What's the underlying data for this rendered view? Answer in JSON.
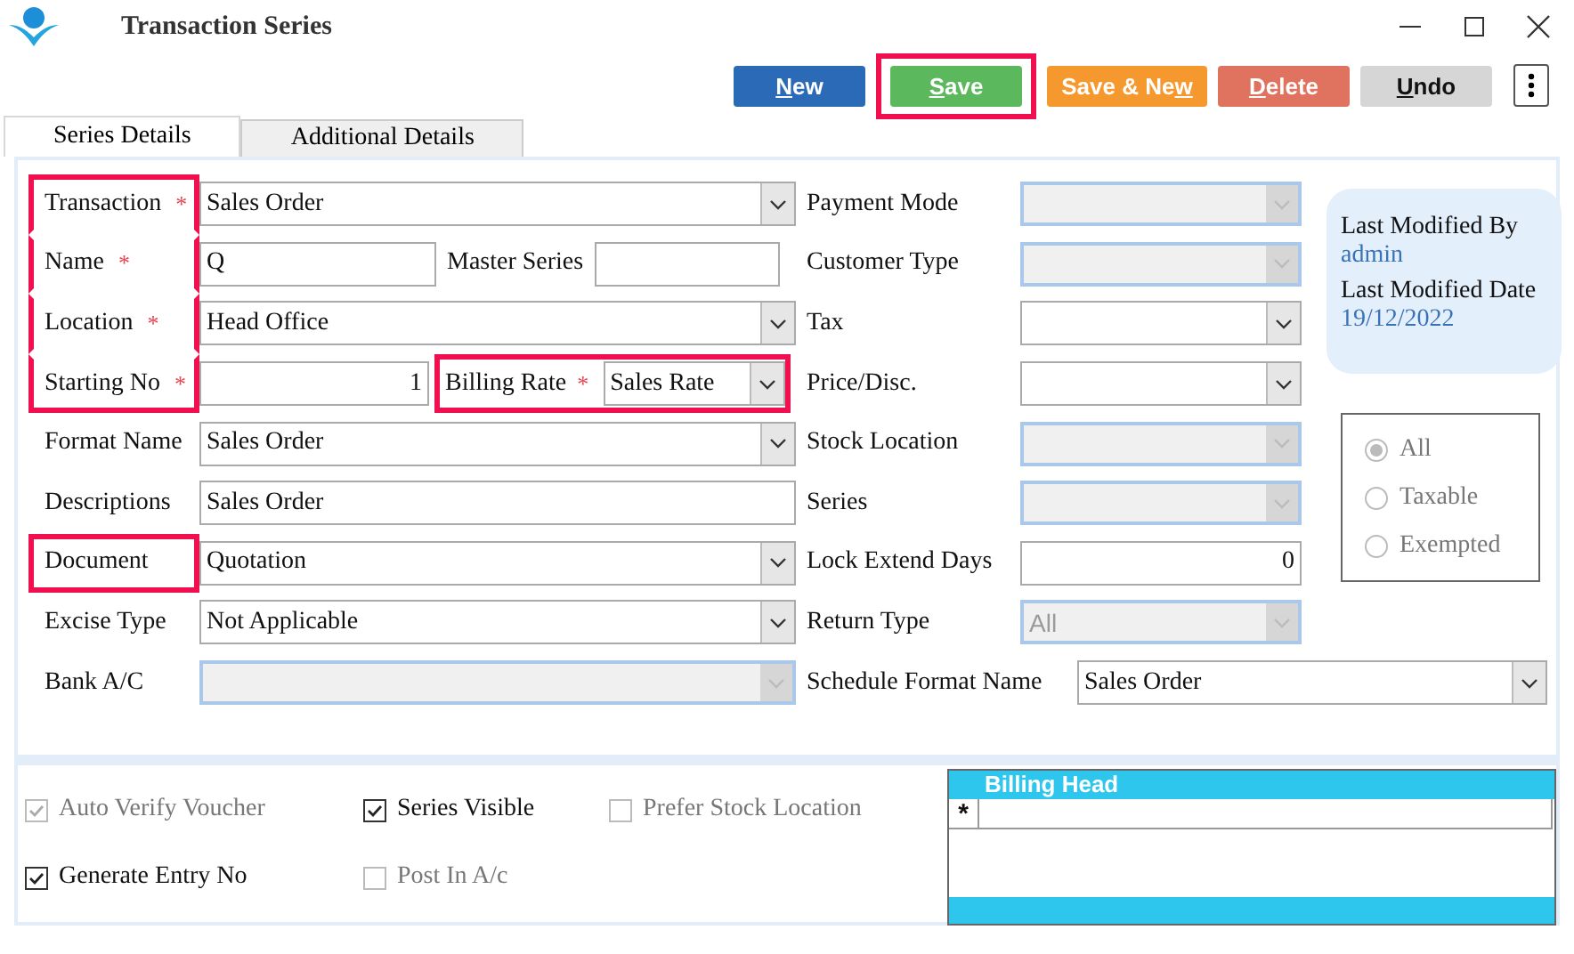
{
  "window": {
    "title": "Transaction Series"
  },
  "toolbar": {
    "buttons": [
      {
        "kind": "primary",
        "key": "N",
        "after": "ew"
      },
      {
        "kind": "success",
        "key": "S",
        "after": "ave",
        "highlighted": true
      },
      {
        "kind": "warning",
        "before": "Save & Ne",
        "key": "w"
      },
      {
        "kind": "danger",
        "key": "D",
        "after": "elete"
      },
      {
        "kind": "default",
        "key": "U",
        "after": "ndo"
      }
    ]
  },
  "tabs": [
    {
      "label": "Series Details",
      "selected": true
    },
    {
      "label": "Additional Details",
      "selected": false
    }
  ],
  "left_fields": [
    {
      "label": "Transaction",
      "required": true,
      "highlighted": true,
      "kind": "select",
      "value": "Sales Order"
    },
    {
      "label": "Name",
      "required": true,
      "highlighted": true,
      "kind": "text",
      "value": "Q",
      "side": {
        "label": "Master Series",
        "kind": "text"
      }
    },
    {
      "label": "Location",
      "required": true,
      "highlighted": true,
      "kind": "select",
      "value": "Head Office"
    },
    {
      "label": "Starting No",
      "required": true,
      "highlighted": true,
      "kind": "number",
      "value": "1",
      "side": {
        "label": "Billing Rate",
        "required": true,
        "highlighted": true,
        "kind": "select",
        "value": "Sales Rate"
      }
    },
    {
      "label": "Format Name",
      "kind": "select",
      "value": "Sales Order"
    },
    {
      "label": "Descriptions",
      "kind": "text",
      "value": "Sales Order"
    },
    {
      "label": "Document",
      "highlighted": true,
      "kind": "select",
      "value": "Quotation"
    },
    {
      "label": "Excise Type",
      "kind": "select",
      "value": "Not Applicable"
    },
    {
      "label": "Bank A/C",
      "kind": "select",
      "disabled": true
    }
  ],
  "middle_fields": [
    {
      "label": "Payment Mode",
      "kind": "select",
      "disabled": true
    },
    {
      "label": "Customer Type",
      "kind": "select",
      "disabled": true
    },
    {
      "label": "Tax",
      "kind": "select"
    },
    {
      "label": "Price/Disc.",
      "kind": "select"
    },
    {
      "label": "Stock Location",
      "kind": "select",
      "disabled": true
    },
    {
      "label": "Series",
      "kind": "select",
      "disabled": true
    },
    {
      "label": "Lock Extend Days",
      "kind": "number",
      "value": "0"
    },
    {
      "label": "Return Type",
      "kind": "select",
      "value": "All",
      "disabled": true
    }
  ],
  "schedule_field": {
    "label": "Schedule Format Name",
    "kind": "select",
    "value": "Sales Order"
  },
  "info_card": {
    "modified_by_label": "Last Modified By",
    "modified_by": "admin",
    "modified_date_label": "Last Modified Date",
    "modified_date": "19/12/2022"
  },
  "tax_filter": {
    "disabled": true,
    "options": [
      {
        "label": "All",
        "selected": true
      },
      {
        "label": "Taxable",
        "selected": false
      },
      {
        "label": "Exempted",
        "selected": false
      }
    ]
  },
  "options": [
    {
      "label": "Auto Verify Voucher",
      "checked": true,
      "disabled": true
    },
    {
      "label": "Series Visible",
      "checked": true,
      "disabled": false
    },
    {
      "label": "Prefer Stock Location",
      "checked": false,
      "disabled": true
    },
    {
      "label": "Generate Entry No",
      "checked": true,
      "disabled": false
    },
    {
      "label": "Post In A/c",
      "checked": false,
      "disabled": true
    }
  ],
  "billing_grid": {
    "column": "Billing Head",
    "new_row_marker": "*"
  }
}
